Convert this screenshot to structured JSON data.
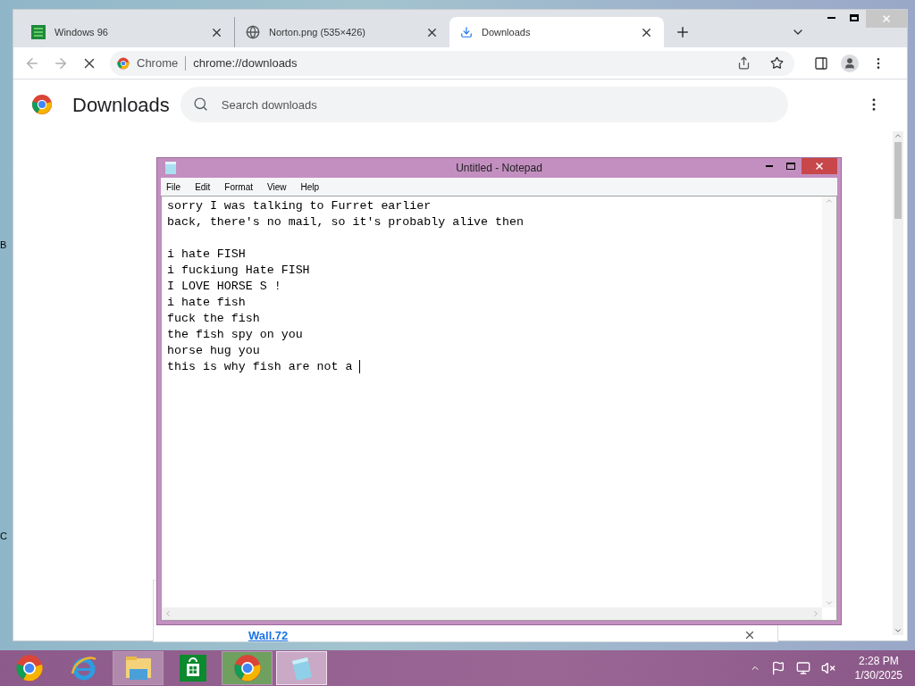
{
  "desktop": {
    "icon_labels": [
      "B",
      "C"
    ]
  },
  "browser": {
    "tabs": [
      {
        "kind": "app",
        "title": "Windows 96",
        "selected": false
      },
      {
        "kind": "web",
        "title": "Norton.png (535×426)",
        "selected": false
      },
      {
        "kind": "download",
        "title": "Downloads",
        "selected": true
      }
    ],
    "omnibox": {
      "site": "Chrome",
      "url": "chrome://downloads"
    },
    "page": {
      "title": "Downloads",
      "search": {
        "placeholder": "Search downloads"
      },
      "download_link": "Wall.72"
    }
  },
  "notepad": {
    "title": "Untitled - Notepad",
    "menu": [
      "File",
      "Edit",
      "Format",
      "View",
      "Help"
    ],
    "text": "sorry I was talking to Furret earlier\nback, there's no mail, so it's probably alive then\n\ni hate FISH\ni fuckiung Hate FISH\nI LOVE HORSE S !\ni hate fish\nfuck the fish\nthe fish spy on you\nhorse hug you\nthis is why fish are not a "
  },
  "taskbar": {
    "apps": [
      {
        "kind": "canary",
        "open": false,
        "selected": false
      },
      {
        "kind": "ie",
        "open": false,
        "selected": false
      },
      {
        "kind": "explorer",
        "open": true,
        "selected": false
      },
      {
        "kind": "store",
        "open": false,
        "selected": false
      },
      {
        "kind": "chrome",
        "open": true,
        "selected": false
      },
      {
        "kind": "notepad",
        "open": true,
        "selected": true
      }
    ],
    "clock": {
      "time": "2:28 PM",
      "date": "1/30/2025"
    }
  }
}
